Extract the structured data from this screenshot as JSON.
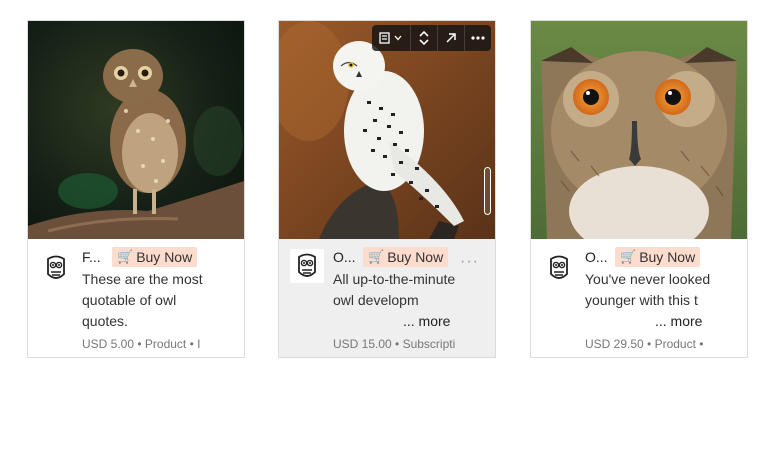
{
  "cards": [
    {
      "title": "F...",
      "buy_label": "Buy Now",
      "cart_icon": "cart-icon",
      "description": "These are the most quotable of owl quotes.",
      "meta": "USD 5.00 • Product • I",
      "image": "burrowing-owl-photo"
    },
    {
      "title": "O...",
      "buy_label": "Buy Now",
      "cart_icon": "cart-icon",
      "description": "All up-to-the-minute owl developm",
      "more_label": "... more",
      "meta": "USD 15.00 • Subscripti",
      "image": "snowy-owl-photo",
      "toolbar": {
        "layout_icon": "layout-dropdown-icon",
        "resize_icon": "expand-vertical-icon",
        "open_icon": "arrow-up-right-icon",
        "menu_icon": "more-horizontal-icon"
      }
    },
    {
      "title": "O...",
      "buy_label": "Buy Now",
      "cart_icon": "cart-icon",
      "description": "You've never looked younger with this t",
      "more_label": "... more",
      "meta": "USD 29.50 • Product •",
      "image": "eagle-owl-photo"
    }
  ],
  "colors": {
    "buy_bg": "#fbdccd",
    "selected_card_bg": "#efefef",
    "border": "#dcdcdc"
  }
}
